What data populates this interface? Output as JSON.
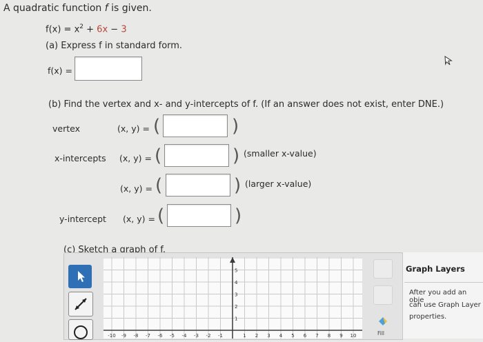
{
  "question": {
    "intro_prefix": "A quadratic function ",
    "intro_var": "f",
    "intro_suffix": " is given.",
    "function_lhs": "f(x) = x",
    "function_exp": "2",
    "function_rest": " + ",
    "function_b": "6x",
    "function_minus": " − ",
    "function_c": "3"
  },
  "part_a": {
    "label": "(a) Express f in standard form.",
    "fx_label": "f(x) ="
  },
  "part_b": {
    "label": "(b) Find the vertex and x- and y-intercepts of f. (If an answer does not exist, enter DNE.)",
    "vertex_label": "vertex",
    "x_intercepts_label": "x-intercepts",
    "y_intercept_label": "y-intercept",
    "xy_eq": "(x, y) =",
    "smaller_note": "(smaller x-value)",
    "larger_note": "(larger x-value)"
  },
  "part_c": {
    "label": "(c) Sketch a graph of f."
  },
  "graph": {
    "x_ticks": [
      "-10",
      "-9",
      "-8",
      "-7",
      "-6",
      "-5",
      "-4",
      "-3",
      "-2",
      "-1",
      "1",
      "2",
      "3",
      "4",
      "5",
      "6",
      "7",
      "8",
      "9",
      "10"
    ],
    "y_ticks": [
      "5",
      "4",
      "3",
      "2",
      "1"
    ],
    "fill_label": "Fill"
  },
  "graph_layers": {
    "title": "Graph Layers",
    "text_line1": "After you add an obje",
    "text_line2": "can use Graph Layer",
    "text_line3": "properties."
  },
  "colors": {
    "accent_red": "#b8453a",
    "tool_blue": "#2f6fb5",
    "axis": "#3a3a3a"
  },
  "icons": [
    "cursor-icon",
    "select-arrow-icon",
    "line-tool-icon",
    "circle-tool-icon",
    "fill-icon"
  ]
}
